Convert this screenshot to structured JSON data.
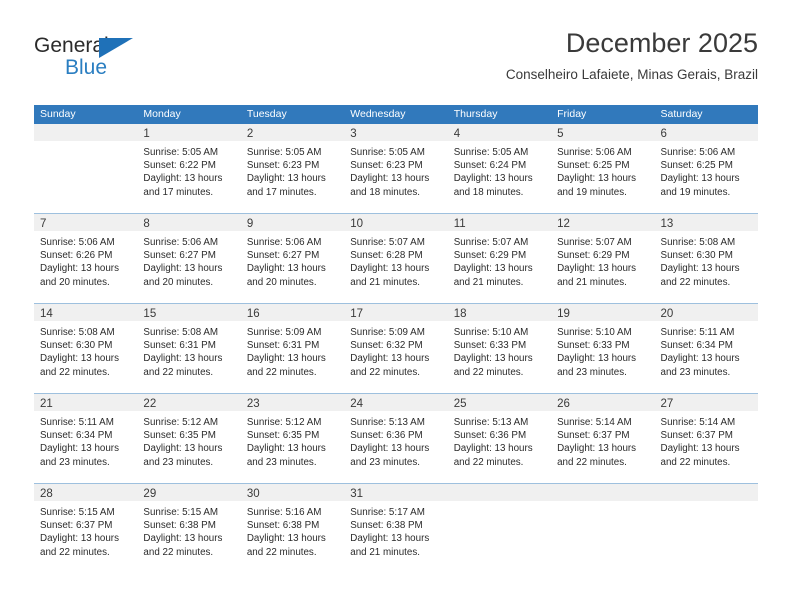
{
  "brand": {
    "name_top": "General",
    "name_bottom": "Blue",
    "flag_icon": "blue-triangle-flag",
    "color_primary": "#2a7ec1",
    "color_text": "#2b2b2b"
  },
  "header": {
    "title": "December 2025",
    "subtitle": "Conselheiro Lafaiete, Minas Gerais, Brazil"
  },
  "calendar": {
    "accent_color": "#3179bc",
    "band_color": "#f0f0f0",
    "weekdays": [
      "Sunday",
      "Monday",
      "Tuesday",
      "Wednesday",
      "Thursday",
      "Friday",
      "Saturday"
    ],
    "weeks": [
      [
        {
          "day": "",
          "empty": true,
          "sunrise": "",
          "sunset": "",
          "daylight_1": "",
          "daylight_2": ""
        },
        {
          "day": "1",
          "empty": false,
          "sunrise": "Sunrise: 5:05 AM",
          "sunset": "Sunset: 6:22 PM",
          "daylight_1": "Daylight: 13 hours",
          "daylight_2": "and 17 minutes."
        },
        {
          "day": "2",
          "empty": false,
          "sunrise": "Sunrise: 5:05 AM",
          "sunset": "Sunset: 6:23 PM",
          "daylight_1": "Daylight: 13 hours",
          "daylight_2": "and 17 minutes."
        },
        {
          "day": "3",
          "empty": false,
          "sunrise": "Sunrise: 5:05 AM",
          "sunset": "Sunset: 6:23 PM",
          "daylight_1": "Daylight: 13 hours",
          "daylight_2": "and 18 minutes."
        },
        {
          "day": "4",
          "empty": false,
          "sunrise": "Sunrise: 5:05 AM",
          "sunset": "Sunset: 6:24 PM",
          "daylight_1": "Daylight: 13 hours",
          "daylight_2": "and 18 minutes."
        },
        {
          "day": "5",
          "empty": false,
          "sunrise": "Sunrise: 5:06 AM",
          "sunset": "Sunset: 6:25 PM",
          "daylight_1": "Daylight: 13 hours",
          "daylight_2": "and 19 minutes."
        },
        {
          "day": "6",
          "empty": false,
          "sunrise": "Sunrise: 5:06 AM",
          "sunset": "Sunset: 6:25 PM",
          "daylight_1": "Daylight: 13 hours",
          "daylight_2": "and 19 minutes."
        }
      ],
      [
        {
          "day": "7",
          "empty": false,
          "sunrise": "Sunrise: 5:06 AM",
          "sunset": "Sunset: 6:26 PM",
          "daylight_1": "Daylight: 13 hours",
          "daylight_2": "and 20 minutes."
        },
        {
          "day": "8",
          "empty": false,
          "sunrise": "Sunrise: 5:06 AM",
          "sunset": "Sunset: 6:27 PM",
          "daylight_1": "Daylight: 13 hours",
          "daylight_2": "and 20 minutes."
        },
        {
          "day": "9",
          "empty": false,
          "sunrise": "Sunrise: 5:06 AM",
          "sunset": "Sunset: 6:27 PM",
          "daylight_1": "Daylight: 13 hours",
          "daylight_2": "and 20 minutes."
        },
        {
          "day": "10",
          "empty": false,
          "sunrise": "Sunrise: 5:07 AM",
          "sunset": "Sunset: 6:28 PM",
          "daylight_1": "Daylight: 13 hours",
          "daylight_2": "and 21 minutes."
        },
        {
          "day": "11",
          "empty": false,
          "sunrise": "Sunrise: 5:07 AM",
          "sunset": "Sunset: 6:29 PM",
          "daylight_1": "Daylight: 13 hours",
          "daylight_2": "and 21 minutes."
        },
        {
          "day": "12",
          "empty": false,
          "sunrise": "Sunrise: 5:07 AM",
          "sunset": "Sunset: 6:29 PM",
          "daylight_1": "Daylight: 13 hours",
          "daylight_2": "and 21 minutes."
        },
        {
          "day": "13",
          "empty": false,
          "sunrise": "Sunrise: 5:08 AM",
          "sunset": "Sunset: 6:30 PM",
          "daylight_1": "Daylight: 13 hours",
          "daylight_2": "and 22 minutes."
        }
      ],
      [
        {
          "day": "14",
          "empty": false,
          "sunrise": "Sunrise: 5:08 AM",
          "sunset": "Sunset: 6:30 PM",
          "daylight_1": "Daylight: 13 hours",
          "daylight_2": "and 22 minutes."
        },
        {
          "day": "15",
          "empty": false,
          "sunrise": "Sunrise: 5:08 AM",
          "sunset": "Sunset: 6:31 PM",
          "daylight_1": "Daylight: 13 hours",
          "daylight_2": "and 22 minutes."
        },
        {
          "day": "16",
          "empty": false,
          "sunrise": "Sunrise: 5:09 AM",
          "sunset": "Sunset: 6:31 PM",
          "daylight_1": "Daylight: 13 hours",
          "daylight_2": "and 22 minutes."
        },
        {
          "day": "17",
          "empty": false,
          "sunrise": "Sunrise: 5:09 AM",
          "sunset": "Sunset: 6:32 PM",
          "daylight_1": "Daylight: 13 hours",
          "daylight_2": "and 22 minutes."
        },
        {
          "day": "18",
          "empty": false,
          "sunrise": "Sunrise: 5:10 AM",
          "sunset": "Sunset: 6:33 PM",
          "daylight_1": "Daylight: 13 hours",
          "daylight_2": "and 22 minutes."
        },
        {
          "day": "19",
          "empty": false,
          "sunrise": "Sunrise: 5:10 AM",
          "sunset": "Sunset: 6:33 PM",
          "daylight_1": "Daylight: 13 hours",
          "daylight_2": "and 23 minutes."
        },
        {
          "day": "20",
          "empty": false,
          "sunrise": "Sunrise: 5:11 AM",
          "sunset": "Sunset: 6:34 PM",
          "daylight_1": "Daylight: 13 hours",
          "daylight_2": "and 23 minutes."
        }
      ],
      [
        {
          "day": "21",
          "empty": false,
          "sunrise": "Sunrise: 5:11 AM",
          "sunset": "Sunset: 6:34 PM",
          "daylight_1": "Daylight: 13 hours",
          "daylight_2": "and 23 minutes."
        },
        {
          "day": "22",
          "empty": false,
          "sunrise": "Sunrise: 5:12 AM",
          "sunset": "Sunset: 6:35 PM",
          "daylight_1": "Daylight: 13 hours",
          "daylight_2": "and 23 minutes."
        },
        {
          "day": "23",
          "empty": false,
          "sunrise": "Sunrise: 5:12 AM",
          "sunset": "Sunset: 6:35 PM",
          "daylight_1": "Daylight: 13 hours",
          "daylight_2": "and 23 minutes."
        },
        {
          "day": "24",
          "empty": false,
          "sunrise": "Sunrise: 5:13 AM",
          "sunset": "Sunset: 6:36 PM",
          "daylight_1": "Daylight: 13 hours",
          "daylight_2": "and 23 minutes."
        },
        {
          "day": "25",
          "empty": false,
          "sunrise": "Sunrise: 5:13 AM",
          "sunset": "Sunset: 6:36 PM",
          "daylight_1": "Daylight: 13 hours",
          "daylight_2": "and 22 minutes."
        },
        {
          "day": "26",
          "empty": false,
          "sunrise": "Sunrise: 5:14 AM",
          "sunset": "Sunset: 6:37 PM",
          "daylight_1": "Daylight: 13 hours",
          "daylight_2": "and 22 minutes."
        },
        {
          "day": "27",
          "empty": false,
          "sunrise": "Sunrise: 5:14 AM",
          "sunset": "Sunset: 6:37 PM",
          "daylight_1": "Daylight: 13 hours",
          "daylight_2": "and 22 minutes."
        }
      ],
      [
        {
          "day": "28",
          "empty": false,
          "sunrise": "Sunrise: 5:15 AM",
          "sunset": "Sunset: 6:37 PM",
          "daylight_1": "Daylight: 13 hours",
          "daylight_2": "and 22 minutes."
        },
        {
          "day": "29",
          "empty": false,
          "sunrise": "Sunrise: 5:15 AM",
          "sunset": "Sunset: 6:38 PM",
          "daylight_1": "Daylight: 13 hours",
          "daylight_2": "and 22 minutes."
        },
        {
          "day": "30",
          "empty": false,
          "sunrise": "Sunrise: 5:16 AM",
          "sunset": "Sunset: 6:38 PM",
          "daylight_1": "Daylight: 13 hours",
          "daylight_2": "and 22 minutes."
        },
        {
          "day": "31",
          "empty": false,
          "sunrise": "Sunrise: 5:17 AM",
          "sunset": "Sunset: 6:38 PM",
          "daylight_1": "Daylight: 13 hours",
          "daylight_2": "and 21 minutes."
        },
        {
          "day": "",
          "empty": true,
          "sunrise": "",
          "sunset": "",
          "daylight_1": "",
          "daylight_2": ""
        },
        {
          "day": "",
          "empty": true,
          "sunrise": "",
          "sunset": "",
          "daylight_1": "",
          "daylight_2": ""
        },
        {
          "day": "",
          "empty": true,
          "sunrise": "",
          "sunset": "",
          "daylight_1": "",
          "daylight_2": ""
        }
      ]
    ]
  }
}
